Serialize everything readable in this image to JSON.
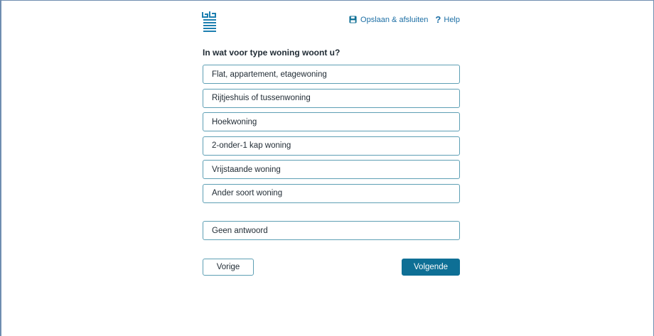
{
  "header": {
    "save_label": "Opslaan & afsluiten",
    "help_label": "Help"
  },
  "question": "In wat voor type woning woont u?",
  "options": [
    "Flat, appartement, etagewoning",
    "Rijtjeshuis of tussenwoning",
    "Hoekwoning",
    "2-onder-1 kap woning",
    "Vrijstaande woning",
    "Ander soort woning"
  ],
  "no_answer": "Geen antwoord",
  "nav": {
    "previous": "Vorige",
    "next": "Volgende"
  },
  "colors": {
    "accent": "#0e6f95",
    "link": "#1d6fa5",
    "option_border": "#5e9fb4"
  }
}
